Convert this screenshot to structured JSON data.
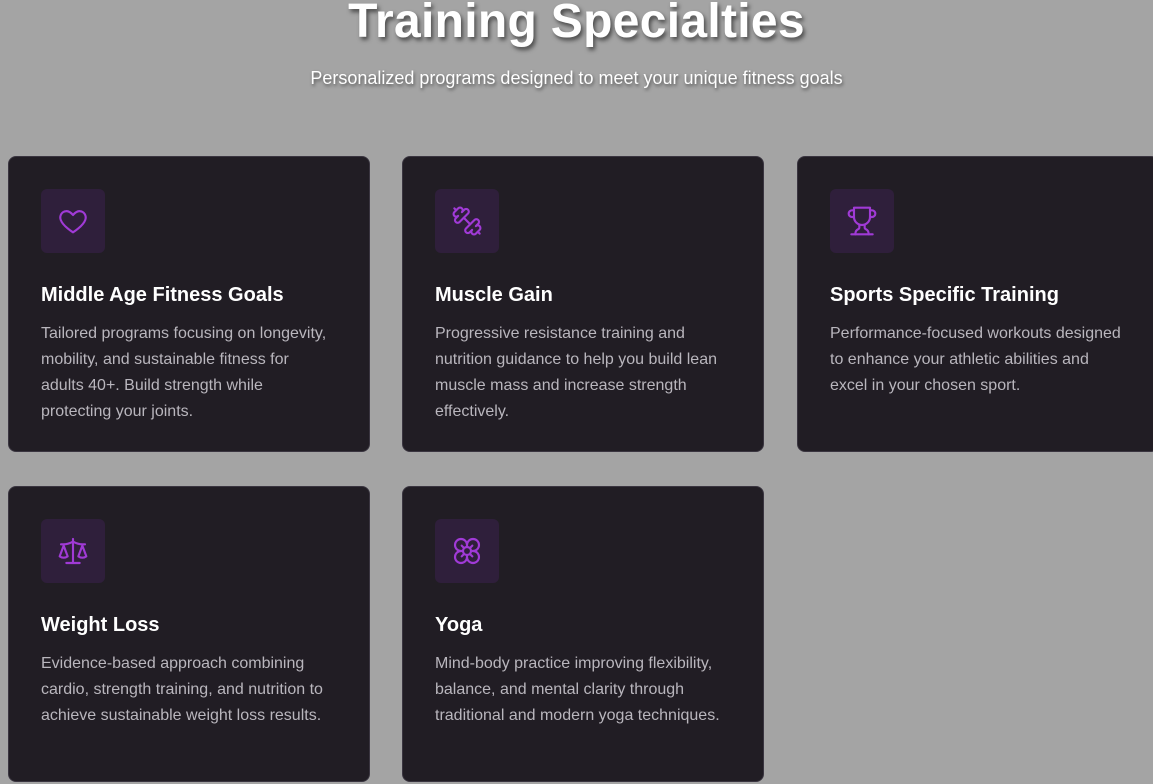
{
  "header": {
    "title": "Training Specialties",
    "subtitle": "Personalized programs designed to meet your unique fitness goals"
  },
  "colors": {
    "background": "#a4a4a4",
    "card": "#211d24",
    "accent": "#a03ad6",
    "icon_bg": "#2f1f3b"
  },
  "cards": [
    {
      "icon": "heart-icon",
      "title": "Middle Age Fitness Goals",
      "description": "Tailored programs focusing on longevity, mobility, and sustainable fitness for adults 40+. Build strength while protecting your joints."
    },
    {
      "icon": "dumbbell-icon",
      "title": "Muscle Gain",
      "description": "Progressive resistance training and nutrition guidance to help you build lean muscle mass and increase strength effectively."
    },
    {
      "icon": "trophy-icon",
      "title": "Sports Specific Training",
      "description": "Performance-focused workouts designed to enhance your athletic abilities and excel in your chosen sport."
    },
    {
      "icon": "scale-icon",
      "title": "Weight Loss",
      "description": "Evidence-based approach combining cardio, strength training, and nutrition to achieve sustainable weight loss results."
    },
    {
      "icon": "flower-icon",
      "title": "Yoga",
      "description": "Mind-body practice improving flexibility, balance, and mental clarity through traditional and modern yoga techniques."
    }
  ]
}
